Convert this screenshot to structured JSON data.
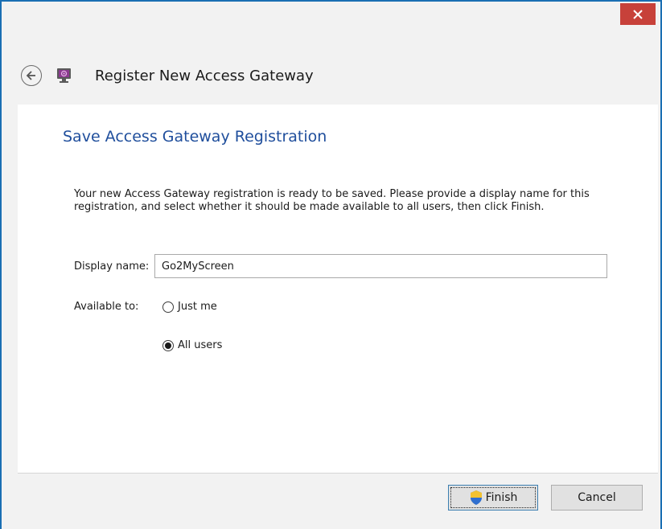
{
  "window": {
    "close_symbol": "×"
  },
  "header": {
    "title": "Register New Access Gateway",
    "back_icon": "back-arrow-icon",
    "app_icon": "access-gateway-icon"
  },
  "page": {
    "title": "Save Access Gateway Registration",
    "description": "Your new Access Gateway registration is ready to be saved.  Please provide a display name for this registration, and select whether it should be made available to all users, then click Finish."
  },
  "form": {
    "display_name_label": "Display name:",
    "display_name_value": "Go2MyScreen",
    "available_label": "Available to:",
    "options": [
      {
        "label": "Just me",
        "selected": false
      },
      {
        "label": "All users",
        "selected": true
      }
    ]
  },
  "buttons": {
    "finish": "Finish",
    "cancel": "Cancel"
  },
  "colors": {
    "accent_border": "#1a6fb3",
    "close_button": "#c7413a",
    "title_blue": "#1f4e9c"
  }
}
